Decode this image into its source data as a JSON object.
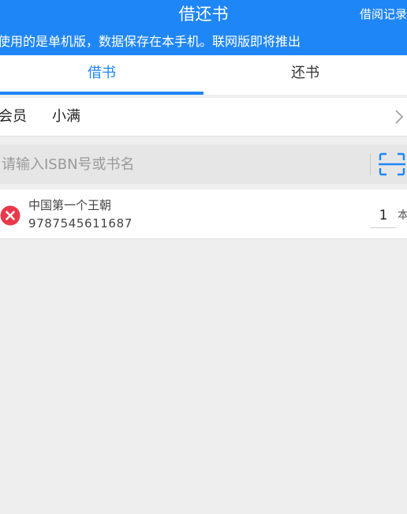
{
  "header": {
    "title": "借还书",
    "history_label": "借阅记录",
    "notice": "使用的是单机版，数据保存在本手机。联网版即将推出"
  },
  "tabs": [
    {
      "label": "借书",
      "active": true
    },
    {
      "label": "还书",
      "active": false
    }
  ],
  "member": {
    "label": "会员",
    "name": "小满"
  },
  "search": {
    "placeholder": "请输入ISBN号或书名",
    "value": ""
  },
  "books": [
    {
      "title": "中国第一个王朝",
      "isbn": "9787545611687",
      "quantity": "1",
      "unit": "本"
    }
  ],
  "colors": {
    "accent": "#1f86f7",
    "delete": "#e8394a",
    "background": "#eeeeee"
  },
  "icons": {
    "chevron": "chevron-right-icon",
    "scan": "scan-icon",
    "delete": "delete-icon"
  }
}
